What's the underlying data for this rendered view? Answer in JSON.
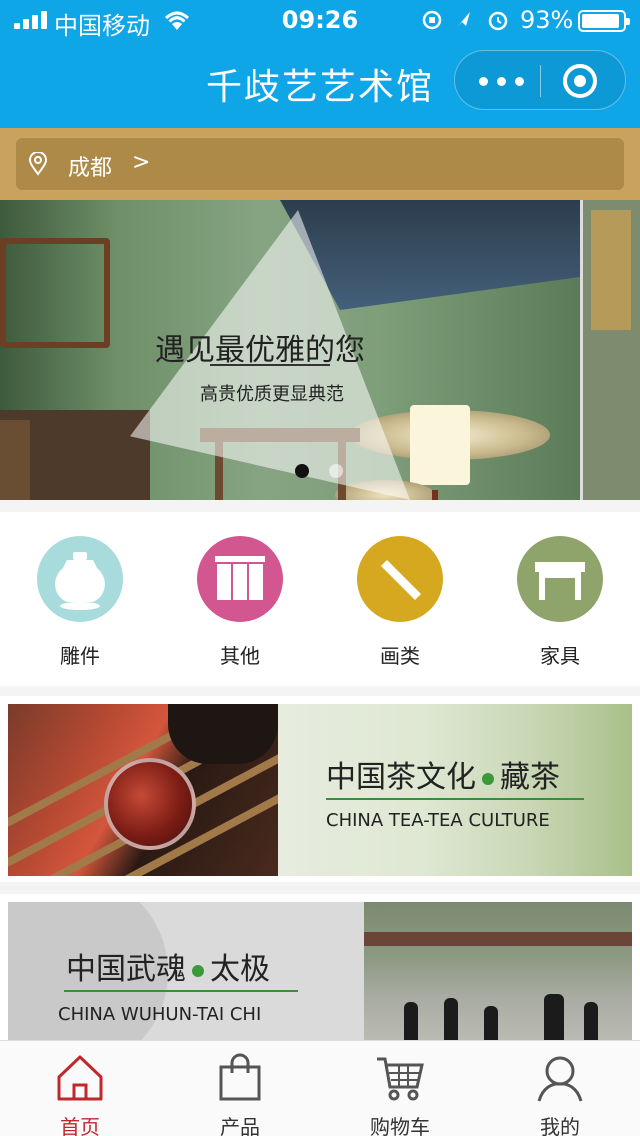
{
  "status_bar": {
    "carrier": "中国移动",
    "time": "09:26",
    "battery": "93%",
    "battery_level": 0.93
  },
  "nav": {
    "title": "千歧艺艺术馆"
  },
  "location": {
    "city": "成都",
    "arrow": ">"
  },
  "banner": {
    "title": "遇见最优雅的您",
    "subtitle": "高贵优质更显典范",
    "active_index": 0,
    "slide_count": 2
  },
  "categories": [
    {
      "label": "雕件",
      "icon": "vase-icon",
      "color": "#a8dcdc"
    },
    {
      "label": "其他",
      "icon": "scroll-icon",
      "color": "#d2568f"
    },
    {
      "label": "画类",
      "icon": "brush-icon",
      "color": "#d6a820"
    },
    {
      "label": "家具",
      "icon": "table-icon",
      "color": "#8fa46a"
    }
  ],
  "promos": [
    {
      "title_cn_a": "中国茶文化",
      "title_cn_b": "藏茶",
      "title_en": "CHINA TEA-TEA CULTURE"
    },
    {
      "title_cn_a": "中国武魂",
      "title_cn_b": "太极",
      "title_en": "CHINA WUHUN-TAI CHI"
    }
  ],
  "tabs": [
    {
      "label": "首页",
      "icon": "home-icon",
      "active": true
    },
    {
      "label": "产品",
      "icon": "bag-icon",
      "active": false
    },
    {
      "label": "购物车",
      "icon": "cart-icon",
      "active": false
    },
    {
      "label": "我的",
      "icon": "user-icon",
      "active": false
    }
  ],
  "colors": {
    "nav_bg": "#0fa6e8",
    "location_bg": "#c9a25e",
    "tab_active": "#c0282e"
  }
}
